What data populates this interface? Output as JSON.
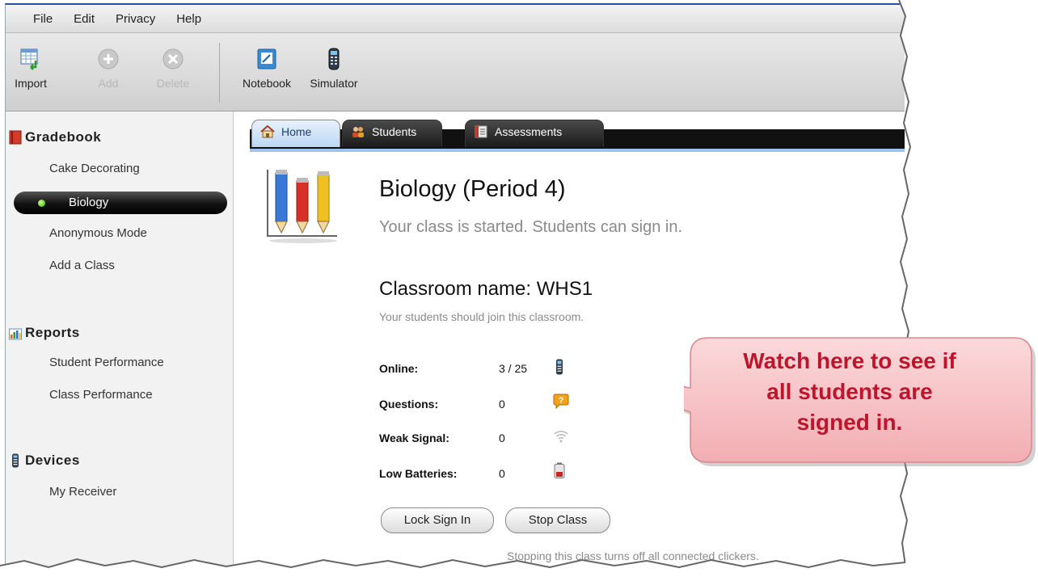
{
  "menu": {
    "file": "File",
    "edit": "Edit",
    "privacy": "Privacy",
    "help": "Help"
  },
  "toolbar": {
    "import": "Import",
    "add": "Add",
    "delete": "Delete",
    "notebook": "Notebook",
    "simulator": "Simulator"
  },
  "sidebar": {
    "gradebook": "Gradebook",
    "classes": [
      "Cake Decorating",
      "Biology",
      "Anonymous Mode",
      "Add a Class"
    ],
    "reports": "Reports",
    "report_items": [
      "Student Performance",
      "Class Performance"
    ],
    "devices": "Devices",
    "device_items": [
      "My Receiver"
    ]
  },
  "tabs": [
    "Home",
    "Students",
    "Assessments"
  ],
  "main": {
    "title": "Biology (Period 4)",
    "subtitle": "Your class is started. Students can sign in.",
    "room_name": "Classroom name: WHS1",
    "room_sub": "Your students should join this classroom.",
    "stats": [
      {
        "label": "Online:",
        "value": "3 / 25",
        "icon": "clicker-icon"
      },
      {
        "label": "Questions:",
        "value": "0",
        "icon": "question-icon"
      },
      {
        "label": "Weak Signal:",
        "value": "0",
        "icon": "wifi-icon"
      },
      {
        "label": "Low Batteries:",
        "value": "0",
        "icon": "battery-icon"
      }
    ],
    "lock_button": "Lock Sign In",
    "stop_button": "Stop Class",
    "footnote": "Stopping this class turns off all connected clickers."
  },
  "callout": {
    "line1": "Watch here to see if",
    "line2": "all students are",
    "line3": "signed in."
  },
  "colors": {
    "accent": "#2a4fa0",
    "callout_text": "#c0142c",
    "callout_bg": "#f7c6c9"
  }
}
